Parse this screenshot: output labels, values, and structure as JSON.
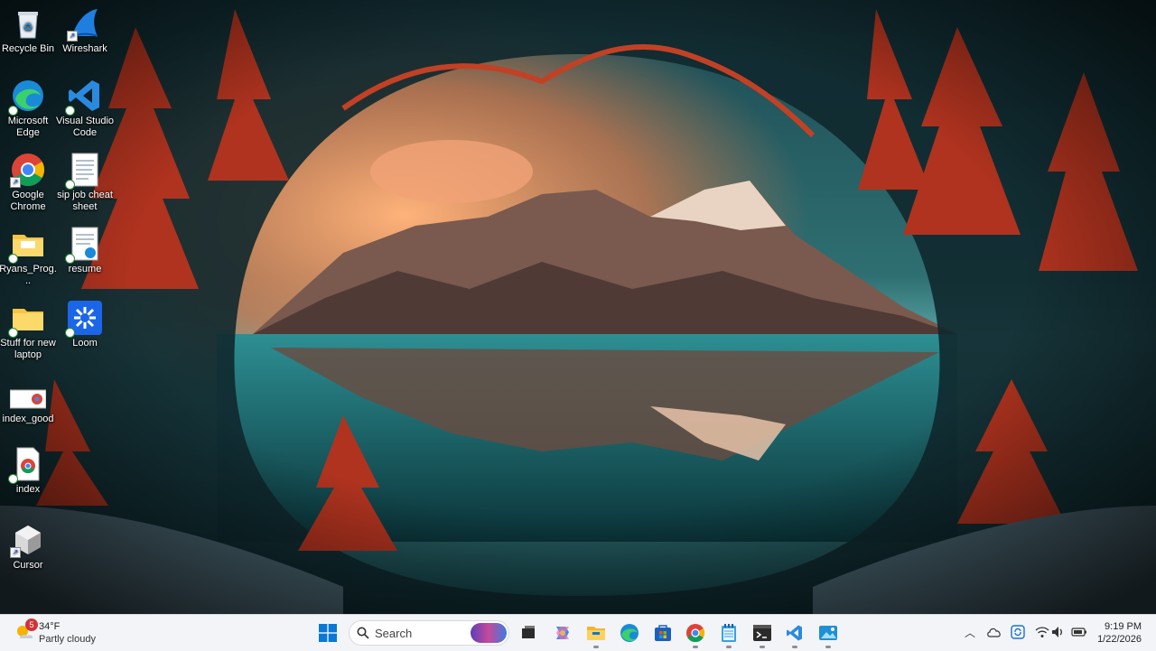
{
  "desktop": {
    "icons": [
      {
        "label": "Recycle Bin",
        "icon": "recycle-bin-icon"
      },
      {
        "label": "Wireshark",
        "icon": "wireshark-icon"
      },
      {
        "label": "Microsoft Edge",
        "icon": "edge-icon"
      },
      {
        "label": "Visual Studio Code",
        "icon": "vscode-icon"
      },
      {
        "label": "Google Chrome",
        "icon": "chrome-icon"
      },
      {
        "label": "sip job cheat sheet",
        "icon": "document-icon"
      },
      {
        "label": "Ryans_Prog...",
        "icon": "folder-icon"
      },
      {
        "label": "resume",
        "icon": "edge-document-icon"
      },
      {
        "label": "Stuff for new laptop",
        "icon": "folder-icon"
      },
      {
        "label": "Loom",
        "icon": "loom-icon"
      },
      {
        "label": "index_good",
        "icon": "chrome-html-icon"
      },
      {
        "label": "index",
        "icon": "chrome-html-icon"
      },
      {
        "label": "Cursor",
        "icon": "cursor-app-icon"
      }
    ]
  },
  "taskbar": {
    "weather": {
      "badge": "5",
      "temp": "34°F",
      "desc": "Partly cloudy",
      "icon": "weather-sun-icon"
    },
    "search": {
      "label": "Search"
    },
    "pinned": [
      {
        "name": "start-icon"
      },
      {
        "name": "task-view-icon"
      },
      {
        "name": "copilot-icon"
      },
      {
        "name": "file-explorer-icon"
      },
      {
        "name": "edge-icon"
      },
      {
        "name": "store-icon"
      },
      {
        "name": "chrome-icon"
      },
      {
        "name": "notepad-icon"
      },
      {
        "name": "terminal-icon"
      },
      {
        "name": "vscode-icon"
      },
      {
        "name": "photos-icon"
      }
    ],
    "tray": {
      "icons": [
        "chevron-up-icon",
        "cloud-icon",
        "refresh-icon",
        "wifi-icon",
        "volume-icon",
        "battery-icon"
      ],
      "time": "9:19 PM",
      "date": "1/22/2026"
    }
  },
  "colors": {
    "taskbar_bg": "#f2f4f7",
    "accent": "#0a63c9"
  }
}
